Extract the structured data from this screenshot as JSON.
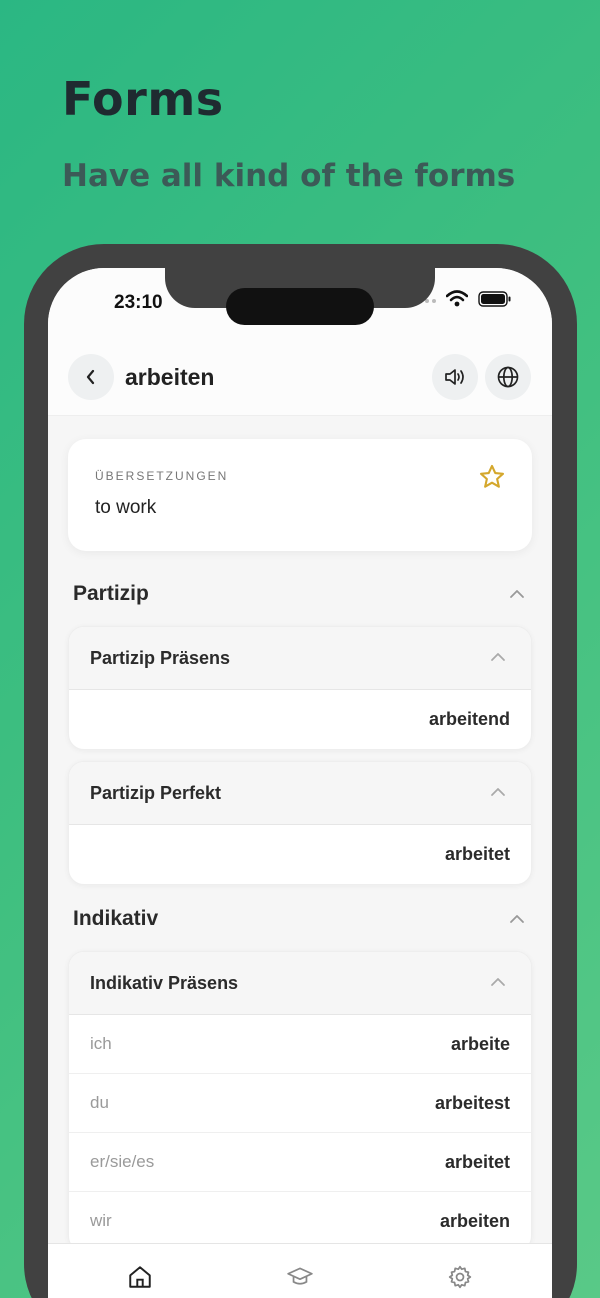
{
  "hero": {
    "title": "Forms",
    "subtitle": "Have all kind of the forms"
  },
  "status_bar": {
    "time": "23:10",
    "icons": [
      "cellular-icon",
      "wifi-icon",
      "battery-icon"
    ]
  },
  "header": {
    "word": "arbeiten",
    "icons": [
      "back-chevron-icon",
      "speaker-icon",
      "globe-icon"
    ]
  },
  "translations": {
    "label": "ÜBERSETZUNGEN",
    "value": "to work",
    "favorite_icon": "star-icon",
    "accent_color": "#d4a72c"
  },
  "sections": [
    {
      "title": "Partizip",
      "groups": [
        {
          "title": "Partizip Präsens",
          "rows": [
            {
              "pronoun": "",
              "form": "arbeitend"
            }
          ]
        },
        {
          "title": "Partizip Perfekt",
          "rows": [
            {
              "pronoun": "",
              "form": "arbeitet"
            }
          ]
        }
      ]
    },
    {
      "title": "Indikativ",
      "groups": [
        {
          "title": "Indikativ Präsens",
          "rows": [
            {
              "pronoun": "ich",
              "form": "arbeite"
            },
            {
              "pronoun": "du",
              "form": "arbeitest"
            },
            {
              "pronoun": "er/sie/es",
              "form": "arbeitet"
            },
            {
              "pronoun": "wir",
              "form": "arbeiten"
            }
          ]
        }
      ]
    }
  ],
  "tabbar": {
    "tabs": [
      {
        "label": "",
        "icon": "home-icon",
        "active": true
      },
      {
        "label": "",
        "icon": "graduation-cap-icon",
        "active": false
      },
      {
        "label": "",
        "icon": "gear-icon",
        "active": false
      }
    ]
  },
  "colors": {
    "background_gradient_start": "#2bb783",
    "background_gradient_end": "#59c987",
    "phone_frame": "#414141"
  }
}
